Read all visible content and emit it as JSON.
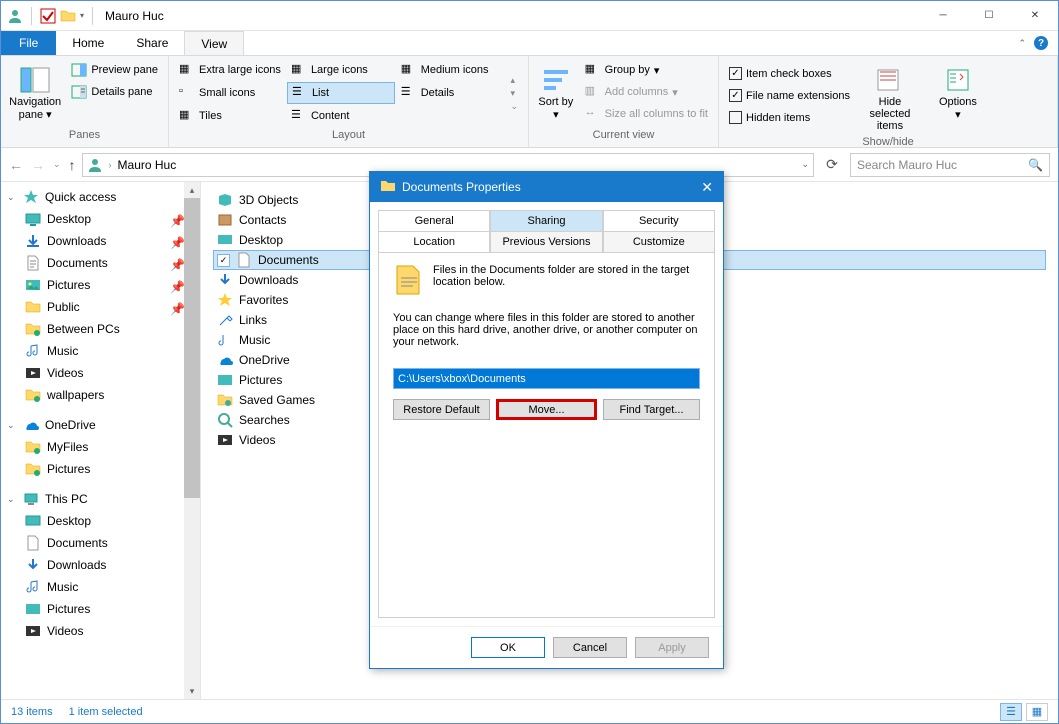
{
  "window": {
    "title": "Mauro Huc"
  },
  "menu": {
    "file": "File",
    "home": "Home",
    "share": "Share",
    "view": "View"
  },
  "ribbon": {
    "panes": {
      "nav": "Navigation pane",
      "preview": "Preview pane",
      "details": "Details pane",
      "label": "Panes"
    },
    "layout": {
      "xl": "Extra large icons",
      "large": "Large icons",
      "medium": "Medium icons",
      "small": "Small icons",
      "list": "List",
      "details": "Details",
      "tiles": "Tiles",
      "content": "Content",
      "label": "Layout"
    },
    "current": {
      "sort": "Sort by",
      "group": "Group by",
      "addcols": "Add columns",
      "sizecols": "Size all columns to fit",
      "label": "Current view"
    },
    "showhide": {
      "itemcheck": "Item check boxes",
      "ext": "File name extensions",
      "hidden": "Hidden items",
      "hidesel": "Hide selected items",
      "options": "Options",
      "label": "Show/hide"
    }
  },
  "nav": {
    "breadcrumb": "Mauro Huc",
    "search_placeholder": "Search Mauro Huc"
  },
  "tree": {
    "quick": "Quick access",
    "desktop": "Desktop",
    "downloads": "Downloads",
    "documents": "Documents",
    "pictures": "Pictures",
    "public": "Public",
    "between": "Between PCs",
    "music": "Music",
    "videos": "Videos",
    "wallpapers": "wallpapers",
    "onedrive": "OneDrive",
    "myfiles": "MyFiles",
    "odpictures": "Pictures",
    "thispc": "This PC",
    "pcdesktop": "Desktop",
    "pcdocs": "Documents",
    "pcdl": "Downloads",
    "pcmusic": "Music",
    "pcpics": "Pictures",
    "pcvideos": "Videos"
  },
  "folders": [
    "3D Objects",
    "Contacts",
    "Desktop",
    "Documents",
    "Downloads",
    "Favorites",
    "Links",
    "Music",
    "OneDrive",
    "Pictures",
    "Saved Games",
    "Searches",
    "Videos"
  ],
  "status": {
    "items": "13 items",
    "selected": "1 item selected"
  },
  "dialog": {
    "title": "Documents Properties",
    "tabs": {
      "general": "General",
      "sharing": "Sharing",
      "security": "Security",
      "location": "Location",
      "prev": "Previous Versions",
      "customize": "Customize"
    },
    "text1": "Files in the Documents folder are stored in the target location below.",
    "text2": "You can change where files in this folder are stored to another place on this hard drive, another drive, or another computer on your network.",
    "path": "C:\\Users\\xbox\\Documents",
    "restore": "Restore Default",
    "move": "Move...",
    "find": "Find Target...",
    "ok": "OK",
    "cancel": "Cancel",
    "apply": "Apply"
  }
}
